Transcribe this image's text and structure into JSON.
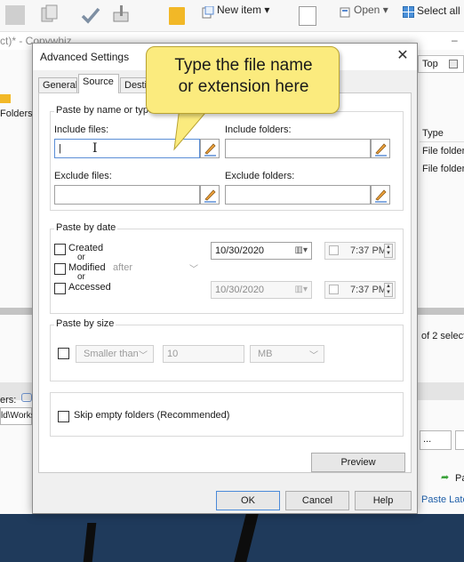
{
  "ribbon": {
    "new_item": "New item",
    "open": "Open",
    "select_all": "Select all"
  },
  "app": {
    "title": "ct)* - Copywhiz",
    "top_button": "Top",
    "folders_label": "Folders.",
    "type_header": "Type",
    "file_folder_1": "File folder",
    "file_folder_2": "File folder",
    "selection_count": "of 2 select",
    "left_filter_label": "ers:",
    "left_path": "ld\\Works",
    "ellipsis_button": "...",
    "paste_label": "Pa",
    "paste_later": "Paste Late"
  },
  "dialog": {
    "title": "Advanced Settings",
    "close": "✕",
    "tabs": [
      "General",
      "Source",
      "Desti"
    ],
    "active_tab": "Source",
    "name_group": {
      "legend": "Paste by name or type",
      "include_files_label": "Include files:",
      "include_files_value": "|",
      "include_folders_label": "Include folders:",
      "include_folders_value": "",
      "exclude_files_label": "Exclude files:",
      "exclude_files_value": "",
      "exclude_folders_label": "Exclude folders:",
      "exclude_folders_value": ""
    },
    "date_group": {
      "legend": "Paste by date",
      "created": "Created",
      "or1": "or",
      "modified": "Modified",
      "or2": "or",
      "accessed": "Accessed",
      "condition": "after",
      "date1": "10/30/2020",
      "time1": "7:37 PM",
      "date2": "10/30/2020",
      "time2": "7:37 PM"
    },
    "size_group": {
      "legend": "Paste by size",
      "comparator": "Smaller than",
      "size_value": "10",
      "unit": "MB"
    },
    "skip_empty": "Skip empty folders (Recommended)",
    "preview_button": "Preview",
    "ok_button": "OK",
    "cancel_button": "Cancel",
    "help_button": "Help"
  },
  "callout": {
    "line1": "Type the file name",
    "line2": "or extension here"
  },
  "colors": {
    "callout_fill": "#fbeb7e",
    "focus_border": "#5b8ed6",
    "taskbar": "#1f3a5b"
  }
}
